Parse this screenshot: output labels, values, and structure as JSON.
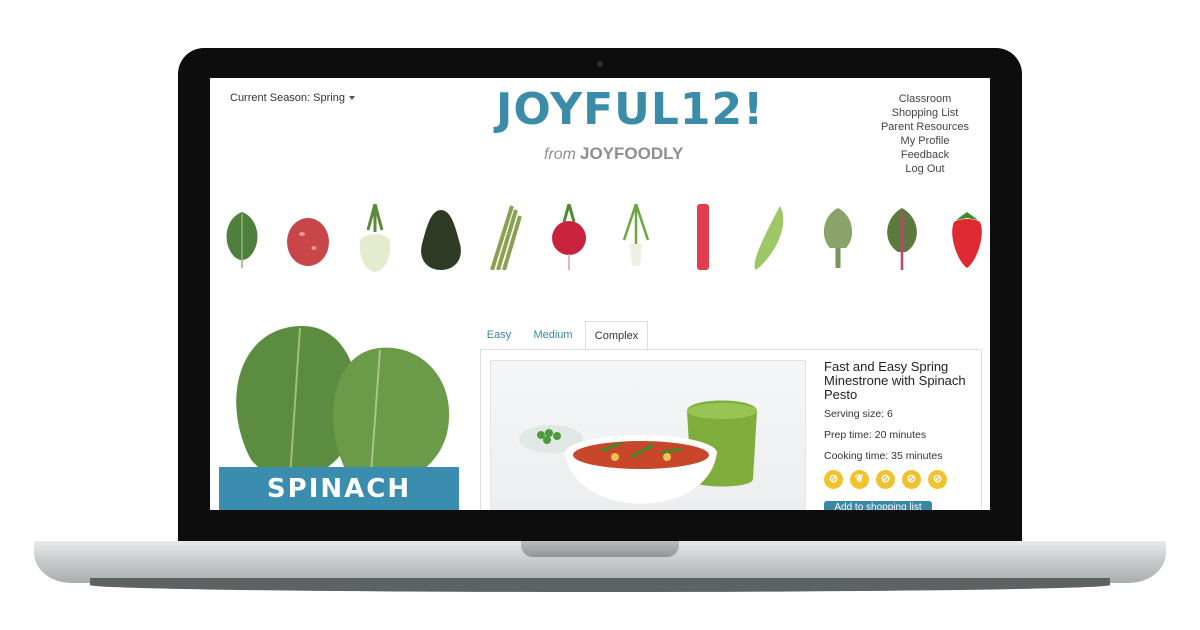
{
  "header": {
    "season_label": "Current Season: Spring",
    "logo_text": "JOYFUL12!",
    "logo_from": "from",
    "logo_brand": "JOYFOODLY"
  },
  "nav": {
    "items": [
      "Classroom",
      "Shopping List",
      "Parent Resources",
      "My Profile",
      "Feedback",
      "Log Out"
    ]
  },
  "produce": [
    "spinach",
    "potato",
    "fennel",
    "avocado",
    "asparagus",
    "radish",
    "green-onion",
    "rhubarb",
    "snap-pea",
    "artichoke",
    "chard",
    "strawberry"
  ],
  "tabs": [
    "Easy",
    "Medium",
    "Complex"
  ],
  "active_tab": "Complex",
  "featured": {
    "label": "SPINACH"
  },
  "recipe": {
    "title": "Fast and Easy Spring Minestrone with Spinach Pesto",
    "serving": "Serving size: 6",
    "prep": "Prep time: 20 minutes",
    "cook": "Cooking time: 35 minutes",
    "diet_icons": [
      "no-gluten-icon",
      "vegetarian-icon",
      "no-nut-icon",
      "no-dairy-icon",
      "no-egg-icon"
    ],
    "add_button": "Add to shopping list"
  },
  "colors": {
    "brand": "#3b8ca9",
    "badge": "#3b8db0",
    "diet_icon": "#f2c12e",
    "laptop_bezel": "#0d0d0d"
  }
}
